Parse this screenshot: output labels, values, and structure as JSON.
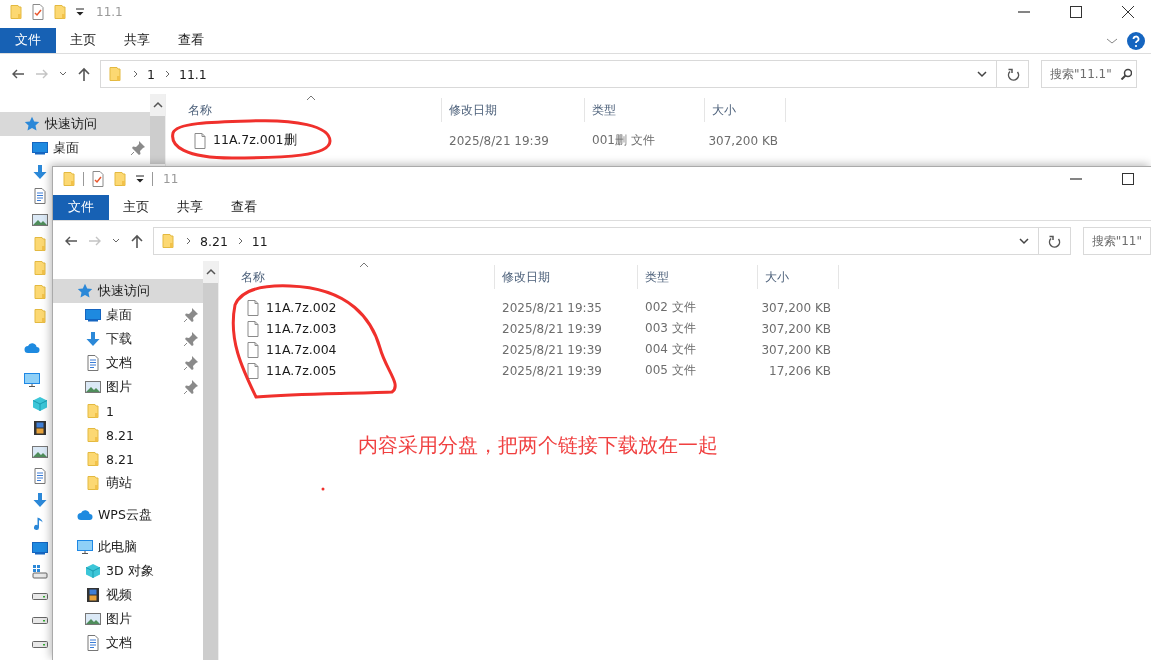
{
  "windows": [
    {
      "title": "11.1",
      "ribbon_tabs": [
        {
          "label": "文件",
          "selected": true
        },
        {
          "label": "主页",
          "selected": false
        },
        {
          "label": "共享",
          "selected": false
        },
        {
          "label": "查看",
          "selected": false
        }
      ],
      "help_button": true,
      "close_button": true,
      "forward_enabled": false,
      "breadcrumb": [
        "1",
        "11.1"
      ],
      "search": {
        "placeholder": "搜索\"11.1\"",
        "show_icon": true
      },
      "sidebar": [
        {
          "kind": "quick",
          "label": "快速访问",
          "selected": true,
          "pinned": false,
          "children": [
            {
              "kind": "desktop",
              "label": "桌面",
              "selected": false,
              "pinned": true
            },
            {
              "kind": "download",
              "selected": false
            },
            {
              "kind": "doc",
              "selected": false
            },
            {
              "kind": "image",
              "selected": false
            },
            {
              "kind": "folder",
              "selected": false
            },
            {
              "kind": "folder",
              "selected": false
            },
            {
              "kind": "folder",
              "selected": false
            },
            {
              "kind": "folder",
              "selected": false
            }
          ]
        },
        {
          "kind": "cloud",
          "selected": false
        },
        {
          "kind": "pc",
          "selected": false,
          "children": [
            {
              "kind": "cube",
              "selected": false
            },
            {
              "kind": "film",
              "selected": false
            },
            {
              "kind": "image",
              "selected": false
            },
            {
              "kind": "doc",
              "selected": false
            },
            {
              "kind": "download",
              "selected": false
            },
            {
              "kind": "music",
              "selected": false
            },
            {
              "kind": "desktop",
              "selected": false
            },
            {
              "kind": "drive-win",
              "selected": false
            },
            {
              "kind": "drive",
              "selected": false
            },
            {
              "kind": "drive",
              "selected": false
            },
            {
              "kind": "drive",
              "selected": false
            }
          ]
        }
      ],
      "columns": [
        "名称",
        "修改日期",
        "类型",
        "大小"
      ],
      "files": [
        {
          "name": "11A.7z.001删",
          "modified": "2025/8/21 19:39",
          "type": "001删 文件",
          "size": "307,200 KB"
        }
      ]
    },
    {
      "title": "11",
      "ribbon_tabs": [
        {
          "label": "文件",
          "selected": true
        },
        {
          "label": "主页",
          "selected": false
        },
        {
          "label": "共享",
          "selected": false
        },
        {
          "label": "查看",
          "selected": false
        }
      ],
      "help_button": false,
      "close_button": false,
      "forward_enabled": false,
      "breadcrumb": [
        "8.21",
        "11"
      ],
      "search": {
        "placeholder": "搜索\"11\"",
        "show_icon": false
      },
      "sidebar": [
        {
          "kind": "quick",
          "label": "快速访问",
          "selected": true,
          "pinned": false,
          "children": [
            {
              "kind": "desktop",
              "label": "桌面",
              "selected": false,
              "pinned": true
            },
            {
              "kind": "download",
              "label": "下载",
              "selected": false,
              "pinned": true
            },
            {
              "kind": "doc",
              "label": "文档",
              "selected": false,
              "pinned": true
            },
            {
              "kind": "image",
              "label": "图片",
              "selected": false,
              "pinned": true
            },
            {
              "kind": "folder",
              "label": "1",
              "selected": false,
              "pinned": false
            },
            {
              "kind": "folder",
              "label": "8.21",
              "selected": false,
              "pinned": false
            },
            {
              "kind": "folder",
              "label": "8.21",
              "selected": false,
              "pinned": false
            },
            {
              "kind": "folder",
              "label": "萌站",
              "selected": false,
              "pinned": false
            }
          ]
        },
        {
          "kind": "cloud",
          "label": "WPS云盘",
          "selected": false,
          "pinned": false
        },
        {
          "kind": "pc",
          "label": "此电脑",
          "selected": false,
          "pinned": false,
          "children": [
            {
              "kind": "cube",
              "label": "3D 对象",
              "selected": false,
              "pinned": false
            },
            {
              "kind": "film",
              "label": "视频",
              "selected": false,
              "pinned": false
            },
            {
              "kind": "image",
              "label": "图片",
              "selected": false,
              "pinned": false
            },
            {
              "kind": "doc",
              "label": "文档",
              "selected": false,
              "pinned": false
            }
          ]
        }
      ],
      "columns": [
        "名称",
        "修改日期",
        "类型",
        "大小"
      ],
      "files": [
        {
          "name": "11A.7z.002",
          "modified": "2025/8/21 19:35",
          "type": "002 文件",
          "size": "307,200 KB"
        },
        {
          "name": "11A.7z.003",
          "modified": "2025/8/21 19:39",
          "type": "003 文件",
          "size": "307,200 KB"
        },
        {
          "name": "11A.7z.004",
          "modified": "2025/8/21 19:39",
          "type": "004 文件",
          "size": "307,200 KB"
        },
        {
          "name": "11A.7z.005",
          "modified": "2025/8/21 19:39",
          "type": "005 文件",
          "size": "17,206 KB"
        }
      ]
    }
  ],
  "annotation": {
    "text": "内容采用分盘，把两个链接下载放在一起"
  }
}
